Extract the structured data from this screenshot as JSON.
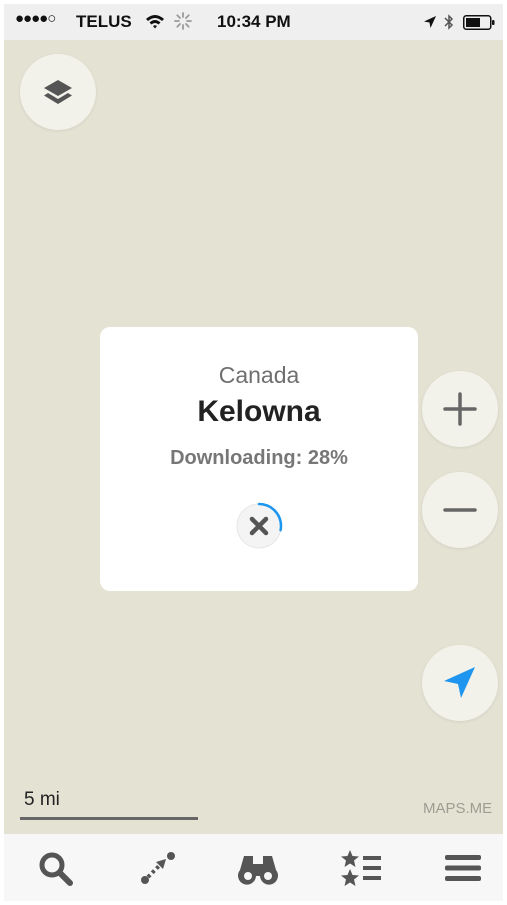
{
  "status_bar": {
    "signal": "●●●●○",
    "carrier": "TELUS",
    "time": "10:34 PM"
  },
  "download_card": {
    "country": "Canada",
    "city": "Kelowna",
    "status": "Downloading: 28%",
    "progress_percent": 28
  },
  "map": {
    "scale_label": "5 mi",
    "brand": "MAPS.ME"
  },
  "icons": {
    "layers": "layers-icon",
    "zoom_in": "plus-icon",
    "zoom_out": "minus-icon",
    "my_position": "location-arrow-icon",
    "search": "search-icon",
    "route": "route-icon",
    "discovery": "binoculars-icon",
    "bookmarks": "bookmarks-icon",
    "menu": "hamburger-icon"
  },
  "colors": {
    "map_background": "#e4e2d3",
    "accent_blue": "#1e96f0",
    "icon_gray": "#555555"
  }
}
